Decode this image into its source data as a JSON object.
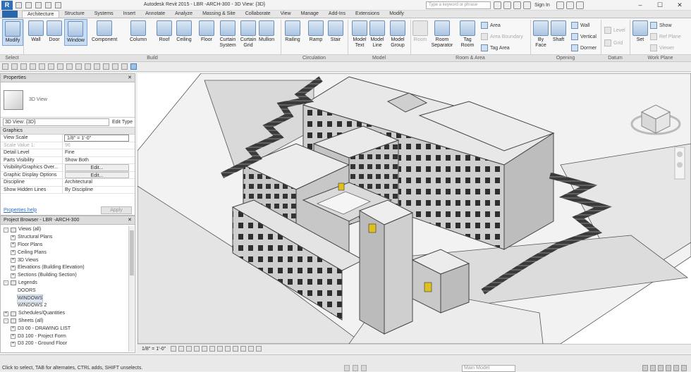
{
  "window": {
    "title": "Autodesk Revit 2015 -    LBR -ARCH-300 - 3D View: {3D}",
    "search_placeholder": "Type a keyword or phrase",
    "sign_in": "Sign In"
  },
  "tabs": [
    "Architecture",
    "Structure",
    "Systems",
    "Insert",
    "Annotate",
    "Analyze",
    "Massing & Site",
    "Collaborate",
    "View",
    "Manage",
    "Add-Ins",
    "Extensions",
    "Modify"
  ],
  "ribbon": {
    "modify": "Modify",
    "wall": "Wall",
    "door": "Door",
    "window": "Window",
    "component": "Component",
    "column": "Column",
    "roof": "Roof",
    "ceiling": "Ceiling",
    "floor": "Floor",
    "curtain_system": "Curtain System",
    "curtain_grid": "Curtain Grid",
    "mullion": "Mullion",
    "railing": "Railing",
    "ramp": "Ramp",
    "stair": "Stair",
    "model_text": "Model Text",
    "model_line": "Model Line",
    "model_group": "Model Group",
    "room": "Room",
    "room_separator": "Room Separator",
    "tag_room": "Tag Room",
    "area": "Area",
    "area_boundary": "Area Boundary",
    "tag_area": "Tag Area",
    "by_face": "By Face",
    "shaft": "Shaft",
    "wall_opening": "Wall",
    "vertical": "Vertical",
    "dormer": "Dormer",
    "level": "Level",
    "grid": "Grid",
    "set": "Set",
    "show": "Show",
    "ref_plane": "Ref Plane",
    "viewer": "Viewer"
  },
  "panels": {
    "select": "Select",
    "build": "Build",
    "circulation": "Circulation",
    "model": "Model",
    "room_area": "Room & Area",
    "opening": "Opening",
    "datum": "Datum",
    "work_plane": "Work Plane"
  },
  "properties": {
    "header": "Properties",
    "type_name": "3D View",
    "selector": "3D View: {3D}",
    "edit_type": "Edit Type",
    "group": "Graphics",
    "rows": [
      {
        "k": "View Scale",
        "v": "1/8\" = 1'-0\""
      },
      {
        "k": "Scale Value    1:",
        "v": "96"
      },
      {
        "k": "Detail Level",
        "v": "Fine"
      },
      {
        "k": "Parts Visibility",
        "v": "Show Both"
      },
      {
        "k": "Visibility/Graphics Over...",
        "v": "Edit..."
      },
      {
        "k": "Graphic Display Options",
        "v": "Edit..."
      },
      {
        "k": "Discipline",
        "v": "Architectural"
      },
      {
        "k": "Show Hidden Lines",
        "v": "By Discipline"
      }
    ],
    "help": "Properties help",
    "apply": "Apply"
  },
  "browser": {
    "header": "Project Browser - LBR -ARCH-300",
    "items": [
      {
        "label": "Views (all)",
        "level": 0,
        "pm": "-"
      },
      {
        "label": "Structural Plans",
        "level": 1,
        "pm": "+"
      },
      {
        "label": "Floor Plans",
        "level": 1,
        "pm": "+"
      },
      {
        "label": "Ceiling Plans",
        "level": 1,
        "pm": "+"
      },
      {
        "label": "3D Views",
        "level": 1,
        "pm": "+"
      },
      {
        "label": "Elevations (Building Elevation)",
        "level": 1,
        "pm": "+"
      },
      {
        "label": "Sections (Building Section)",
        "level": 1,
        "pm": "+"
      },
      {
        "label": "Legends",
        "level": 0,
        "pm": "-"
      },
      {
        "label": "DOORS",
        "level": 2,
        "pm": ""
      },
      {
        "label": "WINDOWS",
        "level": 2,
        "pm": ""
      },
      {
        "label": "WINDOWS 2",
        "level": 2,
        "pm": ""
      },
      {
        "label": "Schedules/Quantities",
        "level": 0,
        "pm": "+"
      },
      {
        "label": "Sheets (all)",
        "level": 0,
        "pm": "-"
      },
      {
        "label": "D3 00 - DRAWING LIST",
        "level": 1,
        "pm": "+"
      },
      {
        "label": "D3 100 - Project Form",
        "level": 1,
        "pm": "+"
      },
      {
        "label": "D3 200 - Ground Floor",
        "level": 1,
        "pm": "+"
      }
    ]
  },
  "viewbar": {
    "scale": "1/8\" = 1'-0\""
  },
  "status": {
    "text": "Click to select, TAB for alternates, CTRL adds, SHIFT unselects.",
    "model": "Main Model"
  }
}
